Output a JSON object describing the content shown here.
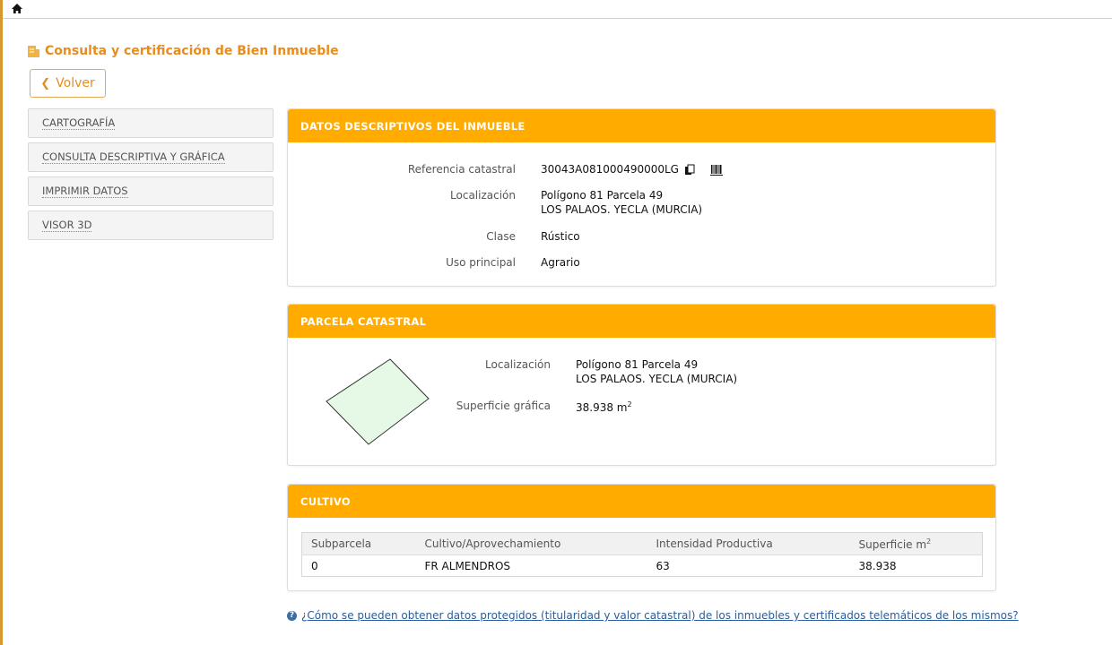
{
  "header": {
    "title": "Consulta y certificación de Bien Inmueble",
    "back_label": "Volver"
  },
  "sidebar": {
    "items": [
      {
        "label": "CARTOGRAFÍA"
      },
      {
        "label": "CONSULTA DESCRIPTIVA Y GRÁFICA"
      },
      {
        "label": "IMPRIMIR DATOS"
      },
      {
        "label": "VISOR 3D"
      }
    ]
  },
  "datos": {
    "header": "DATOS DESCRIPTIVOS DEL INMUEBLE",
    "ref_label": "Referencia catastral",
    "ref_value": "30043A081000490000LG",
    "loc_label": "Localización",
    "loc_line1": "Polígono 81 Parcela 49",
    "loc_line2": "LOS PALAOS. YECLA (MURCIA)",
    "clase_label": "Clase",
    "clase_value": "Rústico",
    "uso_label": "Uso principal",
    "uso_value": "Agrario"
  },
  "parcela": {
    "header": "PARCELA CATASTRAL",
    "loc_label": "Localización",
    "loc_line1": "Polígono 81 Parcela 49",
    "loc_line2": "LOS PALAOS. YECLA (MURCIA)",
    "sup_label": "Superficie gráfica",
    "sup_value": "38.938 m",
    "sup_unit_sup": "2"
  },
  "cultivo": {
    "header": "CULTIVO",
    "columns": [
      "Subparcela",
      "Cultivo/Aprovechamiento",
      "Intensidad Productiva",
      "Superficie m"
    ],
    "col_sup": "2",
    "rows": [
      [
        "0",
        "FR ALMENDROS",
        "63",
        "38.938"
      ]
    ]
  },
  "help": {
    "icon": "?",
    "text": "¿Cómo se pueden obtener datos protegidos (titularidad y valor catastral) de los inmuebles y certificados telemáticos de los mismos?"
  },
  "colors": {
    "accent": "#ffab00",
    "title": "#e98c1d",
    "link": "#2a5d9a"
  }
}
